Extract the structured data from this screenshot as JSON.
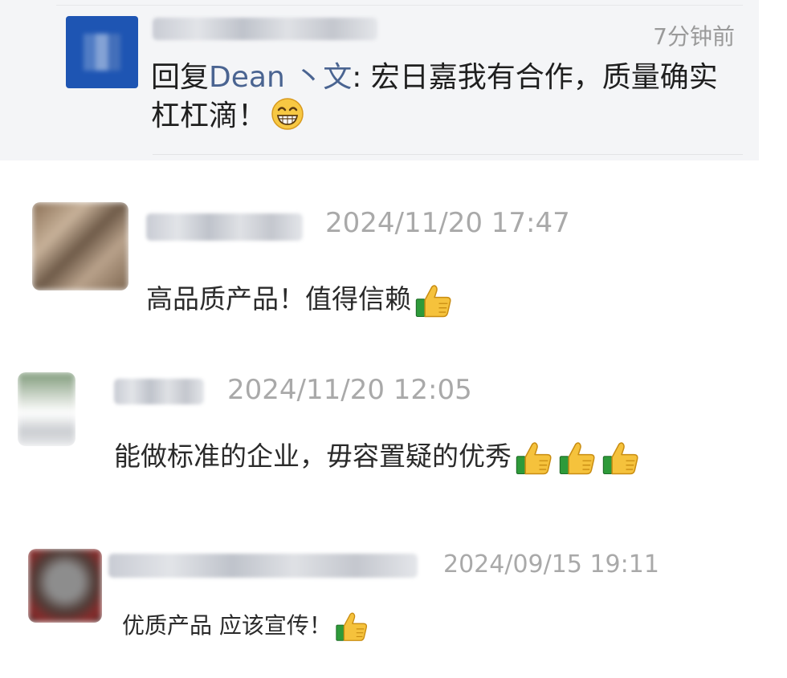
{
  "reply_card": {
    "time_ago": "7分钟前",
    "prefix": "回复",
    "reply_to": "Dean 丶文",
    "colon": ": ",
    "text": "宏日嘉我有合作，质量确实杠杠滴！",
    "emoji": "grin-emoji"
  },
  "comments": [
    {
      "timestamp": "2024/11/20 17:47",
      "text": "高品质产品！值得信赖",
      "thumbs": 1
    },
    {
      "timestamp": "2024/11/20 12:05",
      "text": "能做标准的企业，毋容置疑的优秀",
      "thumbs": 3
    },
    {
      "timestamp": "2024/09/15 19:11",
      "text": "优质产品 应该宣传！",
      "thumbs": 1
    }
  ],
  "colors": {
    "card_bg": "#f4f5f7",
    "name_link": "#4a6491",
    "timestamp": "#a9a9a9",
    "official_avatar": "#1e55b3"
  }
}
